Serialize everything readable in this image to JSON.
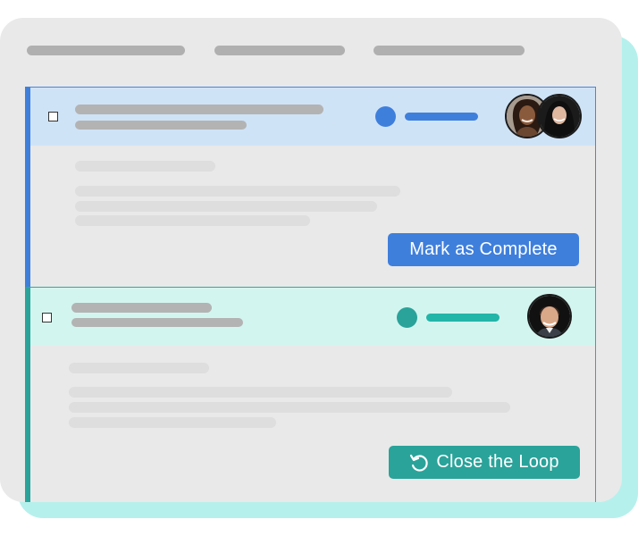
{
  "colors": {
    "blue_accent": "#3f7fdc",
    "teal_accent": "#2aa39a",
    "blue_header": "#cfe3f7",
    "teal_header": "#d3f5ef",
    "panel_bg": "#e9e9e9",
    "shadow_teal": "#b6f0ec"
  },
  "tasks": [
    {
      "status_color": "#3f7fdc",
      "assignees": [
        "woman-avatar-1",
        "woman-avatar-2"
      ],
      "action_label": "Mark as Complete",
      "action_icon": ""
    },
    {
      "status_color": "#2aa39a",
      "assignees": [
        "man-avatar"
      ],
      "action_label": "Close the Loop",
      "action_icon": "undo-arrow-icon"
    }
  ]
}
